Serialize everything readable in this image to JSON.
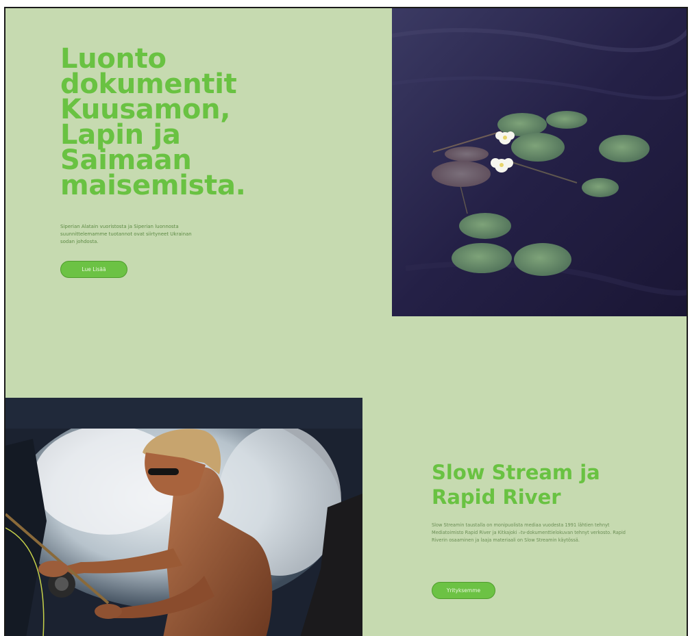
{
  "hero": {
    "title_lines": [
      "Luonto",
      "dokumentit",
      "Kuusamon,",
      "Lapin ja",
      "Saimaan",
      "maisemista."
    ],
    "description": "Siperian Alatain vuoristosta ja Siperian luonnosta suunnittelemamme tuotannot ovat siirtyneet Ukrainan sodan johdosta.",
    "button_label": "Lue Lisää"
  },
  "about": {
    "title_lines": [
      "Slow Stream ja",
      "Rapid River"
    ],
    "description": "Slow Streamin taustalla on monipuolista mediaa vuodesta 1991 lähtien tehnyt Mediatoimisto Rapid River ja Kitkajoki –tv-dokumenttielokuvan tehnyt verkosto. Rapid Riverin osaaminen ja laaja materiaali on Slow Streamin käytössä.",
    "button_label": "Yrityksemme"
  },
  "images": {
    "lily": "water-lilies-photo",
    "fisher": "fly-fisher-rapids-photo"
  },
  "colors": {
    "background": "#c6dab0",
    "accent": "#69c242",
    "button": "#6cc244",
    "body_text": "#5d8a44"
  }
}
